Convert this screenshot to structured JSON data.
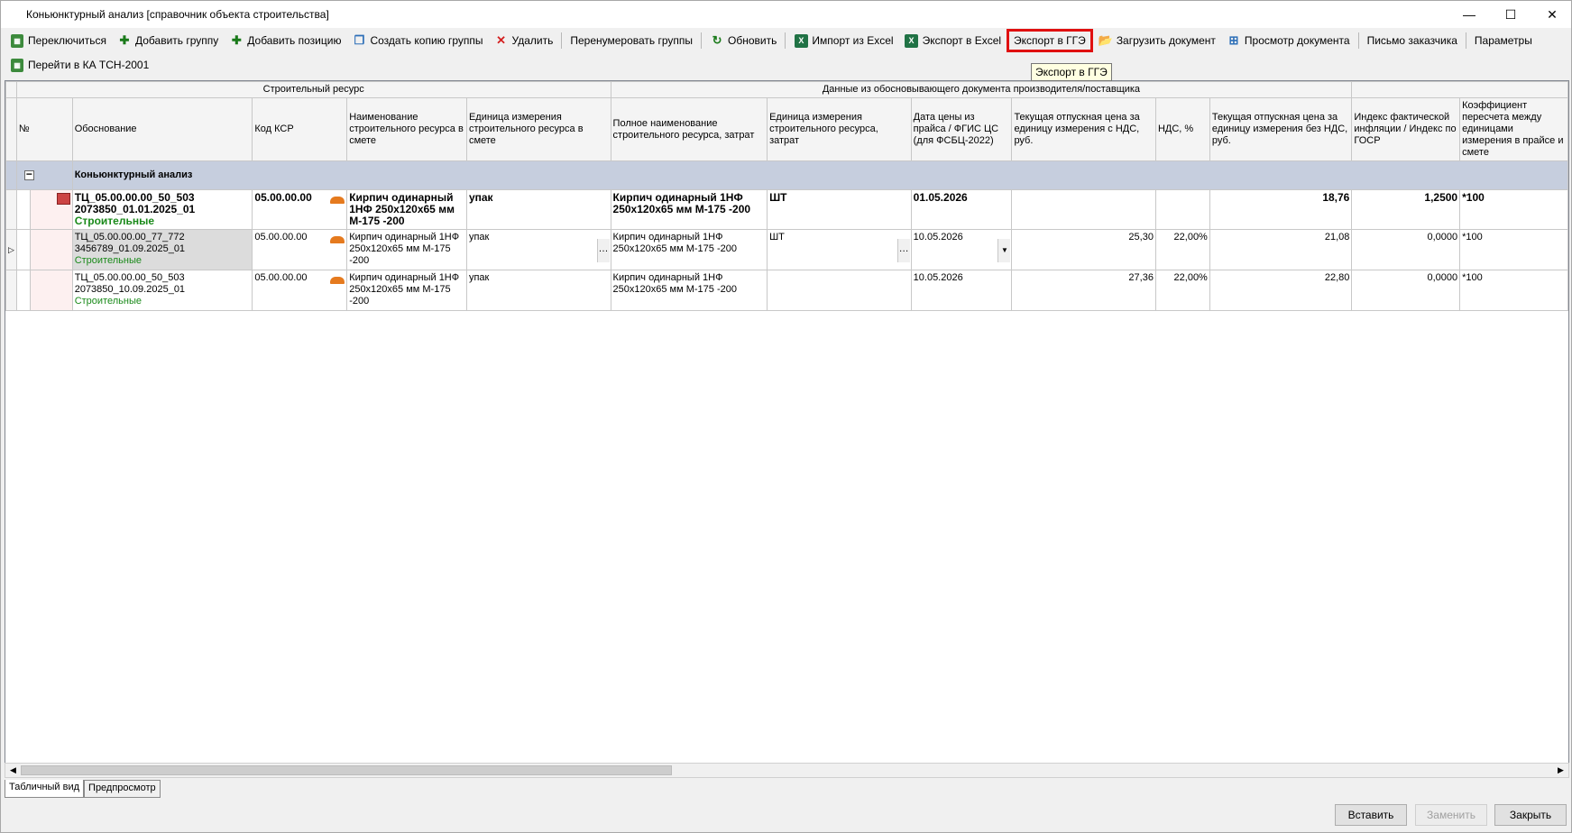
{
  "window": {
    "title": "Коньюнктурный анализ [справочник объекта строительства]",
    "minimize": "—",
    "maximize": "☐",
    "close": "✕"
  },
  "toolbar": {
    "items": [
      {
        "label": "Переключиться",
        "icon": "calculator-icon"
      },
      {
        "label": "Добавить группу",
        "icon": "plus-icon"
      },
      {
        "label": "Добавить позицию",
        "icon": "plus-icon"
      },
      {
        "label": "Создать копию группы",
        "icon": "copy-icon"
      },
      {
        "label": "Удалить",
        "icon": "delete-icon"
      },
      {
        "label": "Перенумеровать группы",
        "icon": ""
      },
      {
        "label": "Обновить",
        "icon": "refresh-icon"
      },
      {
        "label": "Импорт из Excel",
        "icon": "excel-icon"
      },
      {
        "label": "Экспорт в Excel",
        "icon": "excel-icon"
      },
      {
        "label": "Экспорт в ГГЭ",
        "icon": ""
      },
      {
        "label": "Загрузить документ",
        "icon": "upload-icon"
      },
      {
        "label": "Просмотр документа",
        "icon": "preview-icon"
      },
      {
        "label": "Письмо заказчика",
        "icon": ""
      },
      {
        "label": "Параметры",
        "icon": ""
      }
    ],
    "row2": {
      "label": "Перейти в КА ТСН-2001",
      "icon": "calculator-icon"
    }
  },
  "tooltip": "Экспорт в ГГЭ",
  "grid": {
    "bands": {
      "resource": "Строительный ресурс",
      "supplier": "Данные из обосновывающего документа производителя/поставщика"
    },
    "columns": {
      "no": "№",
      "basis": "Обоснование",
      "ksr": "Код КСР",
      "name": "Наименование строительного ресурса в смете",
      "unit": "Единица измерения строительного ресурса в смете",
      "fullname": "Полное наименование строительного ресурса, затрат",
      "unit2": "Единица измерения строительного ресурса, затрат",
      "date": "Дата цены из прайса / ФГИС ЦС (для ФСБЦ-2022)",
      "price_vat": "Текущая отпускная цена за единицу измерения с НДС, руб.",
      "vat": "НДС, %",
      "price_novat": "Текущая отпускная цена за единицу измерения без НДС, руб.",
      "index": "Индекс фактической инфляции / Индекс по ГОСР",
      "coef": "Коэффициент пересчета между единицами измерения в прайсе и смете"
    },
    "group": {
      "toggle": "−",
      "label": "Коньюнктурный анализ"
    },
    "rows": [
      {
        "basis1": "ТЦ_05.00.00.00_50_503",
        "basis2": "2073850_01.01.2025_01",
        "category": "Строительные",
        "ksr": "05.00.00.00",
        "name": "Кирпич одинарный 1НФ 250х120х65 мм М-175 -200",
        "unit": "упак",
        "fullname": "Кирпич одинарный 1НФ 250х120х65 мм М-175 -200",
        "unit2": "ШТ",
        "date": "01.05.2026",
        "price_vat": "",
        "vat": "",
        "price_novat": "18,76",
        "index": "1,2500",
        "coef": "*100"
      },
      {
        "basis1": "ТЦ_05.00.00.00_77_772",
        "basis2": "3456789_01.09.2025_01",
        "category": "Строительные",
        "ksr": "05.00.00.00",
        "name": "Кирпич одинарный 1НФ 250х120х65 мм М-175 -200",
        "unit": "упак",
        "fullname": "Кирпич одинарный 1НФ 250х120х65 мм М-175 -200",
        "unit2": "ШТ",
        "date": "10.05.2026",
        "price_vat": "25,30",
        "vat": "22,00%",
        "price_novat": "21,08",
        "index": "0,0000",
        "coef": "*100"
      },
      {
        "basis1": "ТЦ_05.00.00.00_50_503",
        "basis2": "2073850_10.09.2025_01",
        "category": "Строительные",
        "ksr": "05.00.00.00",
        "name": "Кирпич одинарный 1НФ 250х120х65 мм М-175 -200",
        "unit": "упак",
        "fullname": "Кирпич одинарный 1НФ 250х120х65 мм М-175 -200",
        "unit2": "",
        "date": "10.05.2026",
        "price_vat": "27,36",
        "vat": "22,00%",
        "price_novat": "22,80",
        "index": "0,0000",
        "coef": "*100"
      }
    ]
  },
  "tabs": [
    "Табличный вид",
    "Предпросмотр"
  ],
  "buttons": {
    "insert": "Вставить",
    "replace": "Заменить",
    "close": "Закрыть"
  },
  "colors": {
    "highlight": "#e01010",
    "group_row": "#c6cede",
    "category": "#1a8a1a"
  }
}
